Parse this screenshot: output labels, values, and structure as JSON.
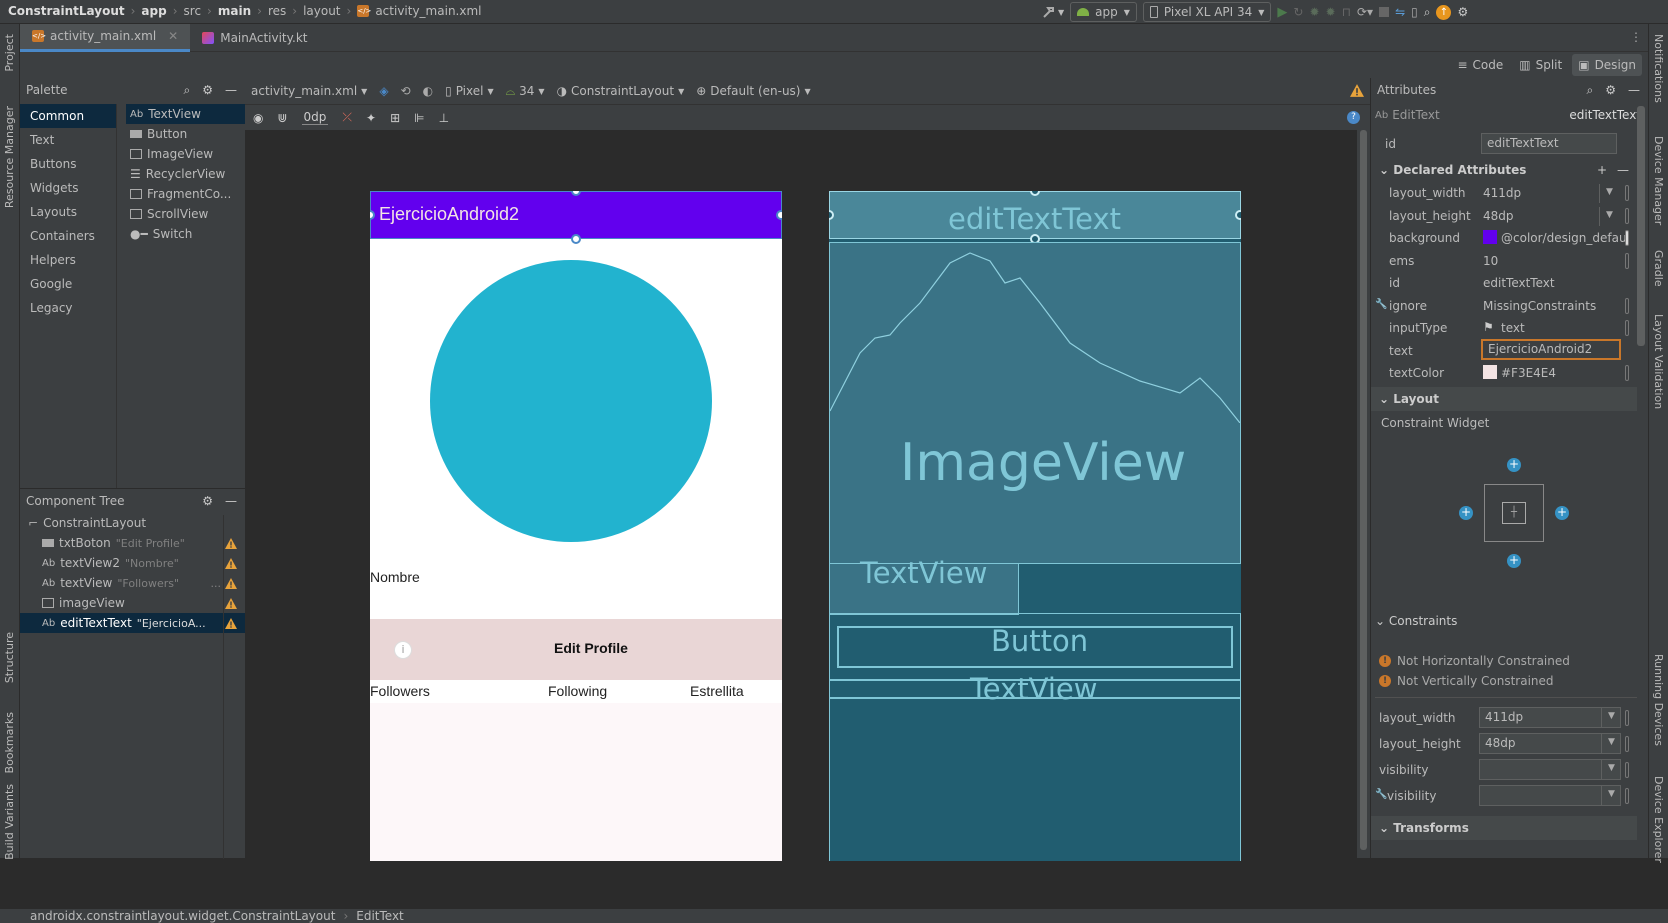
{
  "breadcrumb": [
    "ConstraintLayout",
    "app",
    "src",
    "main",
    "res",
    "layout",
    "activity_main.xml"
  ],
  "toolbar": {
    "run_config": "app",
    "device": "Pixel XL API 34"
  },
  "tabs": [
    {
      "label": "activity_main.xml"
    },
    {
      "label": "MainActivity.kt"
    }
  ],
  "left_strip": {
    "project": "Project",
    "resource_manager": "Resource Manager",
    "structure": "Structure",
    "bookmarks": "Bookmarks",
    "build_variants": "Build Variants"
  },
  "right_strip": {
    "notifications": "Notifications",
    "device_manager": "Device Manager",
    "gradle": "Gradle",
    "layout_validation": "Layout Validation",
    "running_devices": "Running Devices",
    "device_explorer": "Device Explorer"
  },
  "view_modes": {
    "code": "Code",
    "split": "Split",
    "design": "Design"
  },
  "palette": {
    "title": "Palette",
    "categories": [
      "Common",
      "Text",
      "Buttons",
      "Widgets",
      "Layouts",
      "Containers",
      "Helpers",
      "Google",
      "Legacy"
    ],
    "widgets": [
      "TextView",
      "Button",
      "ImageView",
      "RecyclerView",
      "FragmentCo...",
      "ScrollView",
      "Switch"
    ]
  },
  "component_tree": {
    "title": "Component Tree",
    "root": "ConstraintLayout",
    "items": [
      {
        "name": "txtBoton",
        "hint": "\"Edit Profile\""
      },
      {
        "name": "textView2",
        "hint": "\"Nombre\""
      },
      {
        "name": "textView",
        "hint": "\"Followers\""
      },
      {
        "name": "imageView",
        "hint": ""
      },
      {
        "name": "editTextText",
        "hint": "\"EjercicioA..."
      }
    ]
  },
  "editor_toolbar": {
    "file": "activity_main.xml",
    "device": "Pixel",
    "api": "34",
    "layout": "ConstraintLayout",
    "locale": "Default (en-us)",
    "margin": "0dp"
  },
  "design": {
    "appbar_text": "EjercicioAndroid2",
    "name_label": "Nombre",
    "button_label": "Edit Profile",
    "stats": [
      "Followers",
      "Following",
      "Estrellita"
    ]
  },
  "blueprint": {
    "edittext": "editTextText",
    "imageview": "ImageView",
    "textview1": "TextView",
    "button": "Button",
    "textview2": "TextView"
  },
  "attributes": {
    "title": "Attributes",
    "widget_type": "EditText",
    "widget_id": "editTextText",
    "id_label": "id",
    "id_value": "editTextText",
    "declared_title": "Declared Attributes",
    "declared": [
      {
        "key": "layout_width",
        "value": "411dp"
      },
      {
        "key": "layout_height",
        "value": "48dp"
      },
      {
        "key": "background",
        "value": "@color/design_defau"
      },
      {
        "key": "ems",
        "value": "10"
      },
      {
        "key": "id",
        "value": "editTextText"
      },
      {
        "key": "ignore",
        "value": "MissingConstraints"
      },
      {
        "key": "inputType",
        "value": "text"
      },
      {
        "key": "text",
        "value": "EjercicioAndroid2"
      },
      {
        "key": "textColor",
        "value": "#F3E4E4"
      }
    ],
    "layout_title": "Layout",
    "constraint_widget": "Constraint Widget",
    "constraints_title": "Constraints",
    "warnings": [
      "Not Horizontally Constrained",
      "Not Vertically Constrained"
    ],
    "layout_fields": [
      {
        "key": "layout_width",
        "value": "411dp"
      },
      {
        "key": "layout_height",
        "value": "48dp"
      },
      {
        "key": "visibility",
        "value": ""
      },
      {
        "key": "visibility",
        "value": ""
      }
    ],
    "transforms_title": "Transforms"
  },
  "status": [
    "androidx.constraintlayout.widget.ConstraintLayout",
    "EditText"
  ],
  "colors": {
    "accent": "#4a88c7",
    "appbar": "#6200ee",
    "circle": "#22b3cf",
    "blueprint": "#215d70",
    "text_color": "#F3E4E4"
  }
}
